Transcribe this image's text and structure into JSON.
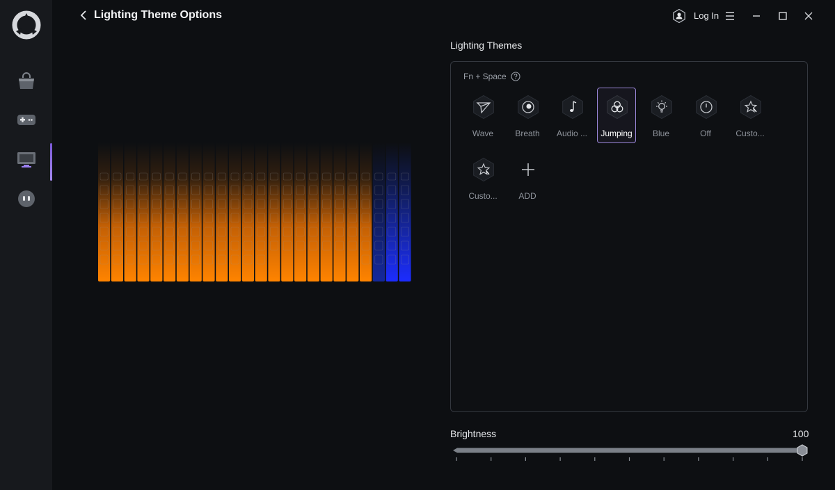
{
  "header": {
    "title": "Lighting Theme Options",
    "login_label": "Log In"
  },
  "themes_panel": {
    "title": "Lighting Themes",
    "hotkey": "Fn + Space",
    "items": [
      {
        "label": "Wave",
        "icon": "paper-plane-icon",
        "selected": false
      },
      {
        "label": "Breath",
        "icon": "breath-icon",
        "selected": false
      },
      {
        "label": "Audio ...",
        "icon": "music-note-icon",
        "selected": false
      },
      {
        "label": "Jumping",
        "icon": "jumping-circles-icon",
        "selected": true
      },
      {
        "label": "Blue",
        "icon": "light-bulb-icon",
        "selected": false
      },
      {
        "label": "Off",
        "icon": "power-icon",
        "selected": false
      },
      {
        "label": "Custo...",
        "icon": "custom-star-icon",
        "selected": false
      },
      {
        "label": "Custo...",
        "icon": "custom-star-icon",
        "selected": false
      },
      {
        "label": "ADD",
        "icon": "plus-icon",
        "selected": false
      }
    ]
  },
  "brightness": {
    "label": "Brightness",
    "value": "100",
    "level": 100,
    "max": 100
  },
  "colors": {
    "accent": "#9a86d8",
    "orange": "#ff7a00",
    "blue": "#1a3cff"
  }
}
